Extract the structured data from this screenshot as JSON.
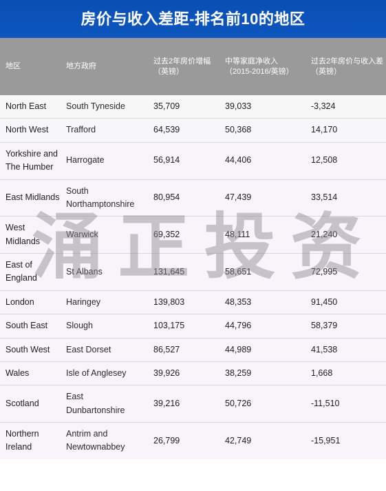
{
  "header": {
    "title": "房价与收入差距-排名前10的地区"
  },
  "watermark": {
    "text": "涌正投资",
    "chars": [
      "涌",
      "正",
      "投",
      "资"
    ]
  },
  "colors": {
    "title_bar": "#0b51b5",
    "table_header": "#9a9a9a",
    "row_background": "#f8f4fa",
    "row_divider": "#d9d4dd",
    "text": "#1d1d1f"
  },
  "table": {
    "columns": [
      {
        "key": "region",
        "label_line1": "地区",
        "label_line2": "",
        "align": "left"
      },
      {
        "key": "council",
        "label_line1": "地方政府",
        "label_line2": "",
        "align": "left"
      },
      {
        "key": "house_price_growth",
        "label_line1": "过去2年房价增幅",
        "label_line2": "（英镑）",
        "align": "left"
      },
      {
        "key": "median_income",
        "label_line1": "中等家庭净收入",
        "label_line2": "（2015-2016/英镑）",
        "align": "left"
      },
      {
        "key": "gap",
        "label_line1": "过去2年房价与收入差",
        "label_line2": "（英镑）",
        "align": "left"
      }
    ],
    "rows": [
      {
        "region": "North East",
        "council": "South Tyneside",
        "house_price_growth": "35,709",
        "median_income": "39,033",
        "gap": "-3,324"
      },
      {
        "region": "North West",
        "council": "Trafford",
        "house_price_growth": "64,539",
        "median_income": "50,368",
        "gap": "14,170"
      },
      {
        "region": "Yorkshire and The Humber",
        "council": "Harrogate",
        "house_price_growth": "56,914",
        "median_income": "44,406",
        "gap": "12,508"
      },
      {
        "region": "East Midlands",
        "council": "South Northamptonshire",
        "house_price_growth": "80,954",
        "median_income": "47,439",
        "gap": "33,514"
      },
      {
        "region": "West Midlands",
        "council": "Warwick",
        "house_price_growth": "69,352",
        "median_income": "48,111",
        "gap": "21,240"
      },
      {
        "region": "East of England",
        "council": "St Albans",
        "house_price_growth": "131,645",
        "median_income": "58,651",
        "gap": "72,995"
      },
      {
        "region": "London",
        "council": "Haringey",
        "house_price_growth": "139,803",
        "median_income": "48,353",
        "gap": "91,450"
      },
      {
        "region": "South East",
        "council": "Slough",
        "house_price_growth": "103,175",
        "median_income": "44,796",
        "gap": "58,379"
      },
      {
        "region": "South West",
        "council": "East Dorset",
        "house_price_growth": "86,527",
        "median_income": "44,989",
        "gap": "41,538"
      },
      {
        "region": "Wales",
        "council": "Isle of Anglesey",
        "house_price_growth": "39,926",
        "median_income": "38,259",
        "gap": "1,668"
      },
      {
        "region": "Scotland",
        "council": "East Dunbartonshire",
        "house_price_growth": "39,216",
        "median_income": "50,726",
        "gap": "-11,510"
      },
      {
        "region": "Northern Ireland",
        "council": "Antrim and Newtownabbey",
        "house_price_growth": "26,799",
        "median_income": "42,749",
        "gap": "-15,951"
      }
    ]
  }
}
